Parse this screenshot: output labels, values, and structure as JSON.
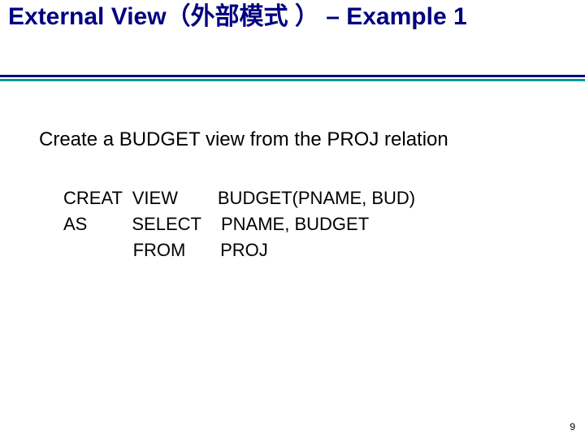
{
  "title": "External View（外部模式 ） – Example 1",
  "subheading": "Create a BUDGET view from the PROJ relation",
  "code_block": "CREAT  VIEW        BUDGET(PNAME, BUD)\nAS         SELECT    PNAME, BUDGET\n              FROM       PROJ",
  "page_number": "9"
}
